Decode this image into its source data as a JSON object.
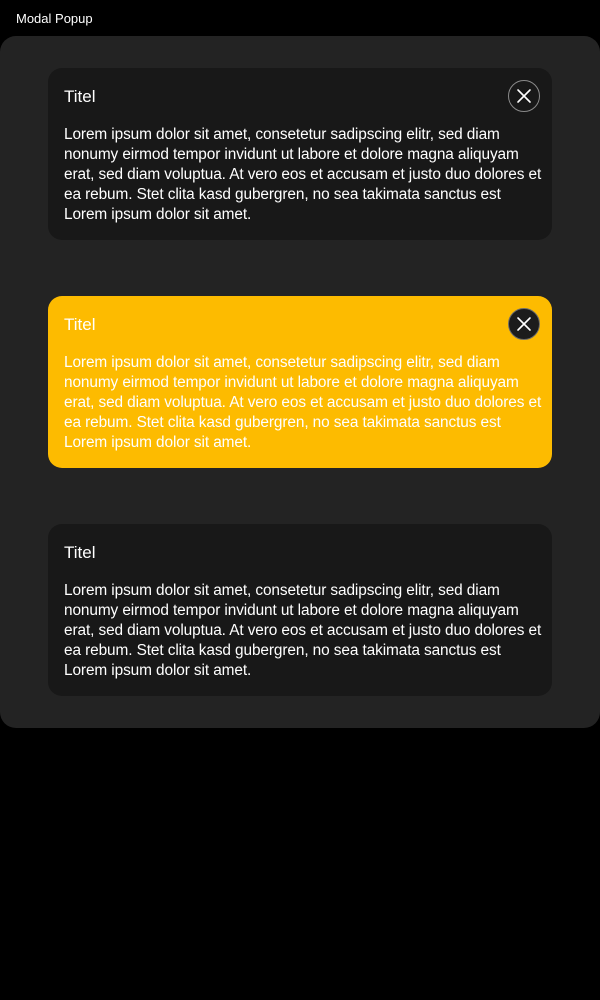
{
  "page": {
    "label": "Modal Popup"
  },
  "colors": {
    "background": "#000000",
    "panel": "#232323",
    "modal_default": "#181818",
    "modal_highlight": "#fdbb00",
    "text": "#ffffff"
  },
  "modals": [
    {
      "variant": "default",
      "title": "Titel",
      "body": "Lorem ipsum dolor sit amet, consetetur sadipscing elitr, sed diam nonumy eirmod tempor invidunt ut labore et dolore magna aliquyam erat, sed diam voluptua. At vero eos et accusam et justo duo dolores et ea rebum. Stet clita kasd gubergren, no sea takimata sanctus est Lorem ipsum dolor sit amet.",
      "close_icon": "close-icon",
      "has_close": true
    },
    {
      "variant": "highlight",
      "title": "Titel",
      "body": "Lorem ipsum dolor sit amet, consetetur sadipscing elitr, sed diam nonumy eirmod tempor invidunt ut labore et dolore magna aliquyam erat, sed diam voluptua. At vero eos et accusam et justo duo dolores et ea rebum. Stet clita kasd gubergren, no sea takimata sanctus est Lorem ipsum dolor sit amet.",
      "close_icon": "close-icon",
      "has_close": true
    },
    {
      "variant": "no-close",
      "title": "Titel",
      "body": "Lorem ipsum dolor sit amet, consetetur sadipscing elitr, sed diam nonumy eirmod tempor invidunt ut labore et dolore magna aliquyam erat, sed diam voluptua. At vero eos et accusam et justo duo dolores et ea rebum. Stet clita kasd gubergren, no sea takimata sanctus est Lorem ipsum dolor sit amet.",
      "has_close": false
    }
  ]
}
